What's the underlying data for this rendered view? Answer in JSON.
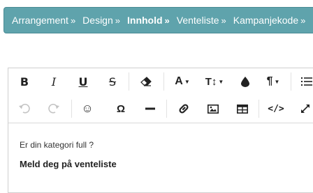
{
  "breadcrumbs": {
    "separator": "»",
    "items": [
      {
        "label": "Arrangement"
      },
      {
        "label": "Design"
      },
      {
        "label": "Innhold"
      },
      {
        "label": "Venteliste"
      },
      {
        "label": "Kampanjekode"
      }
    ],
    "active_index": 2
  },
  "toolbar": {
    "row1": [
      {
        "name": "bold-button",
        "glyph": "B",
        "icon": "bold-icon"
      },
      {
        "name": "italic-button",
        "glyph": "I",
        "icon": "italic-icon"
      },
      {
        "name": "underline-button",
        "glyph": "U",
        "icon": "underline-icon"
      },
      {
        "name": "strikethrough-button",
        "glyph": "S",
        "icon": "strikethrough-icon"
      },
      {
        "name": "clear-formatting-button",
        "icon": "eraser-icon"
      },
      {
        "name": "text-color-button",
        "glyph": "A",
        "icon": "text-color-icon"
      },
      {
        "name": "font-size-button",
        "glyph": "T↕",
        "icon": "font-size-icon"
      },
      {
        "name": "paragraph-color-button",
        "icon": "drop-icon"
      },
      {
        "name": "paragraph-format-button",
        "glyph": "¶",
        "icon": "pilcrow-icon"
      },
      {
        "name": "list-button",
        "icon": "list-icon"
      }
    ],
    "row2": [
      {
        "name": "undo-button",
        "icon": "undo-icon"
      },
      {
        "name": "redo-button",
        "icon": "redo-icon"
      },
      {
        "name": "emoji-button",
        "glyph": "☺",
        "icon": "smiley-icon"
      },
      {
        "name": "special-chars-button",
        "glyph": "Ω",
        "icon": "omega-icon"
      },
      {
        "name": "horizontal-line-button",
        "icon": "minus-icon"
      },
      {
        "name": "link-button",
        "icon": "link-icon"
      },
      {
        "name": "image-button",
        "icon": "image-icon"
      },
      {
        "name": "table-button",
        "icon": "table-icon"
      },
      {
        "name": "code-view-button",
        "glyph": "</>",
        "icon": "code-icon"
      },
      {
        "name": "fullscreen-button",
        "icon": "expand-icon"
      }
    ]
  },
  "content": {
    "line1": "Er din kategori full ?",
    "line2": "Meld deg på venteliste"
  },
  "colors": {
    "breadcrumb_bg": "#5fa3ac",
    "breadcrumb_text": "#ffffff"
  }
}
